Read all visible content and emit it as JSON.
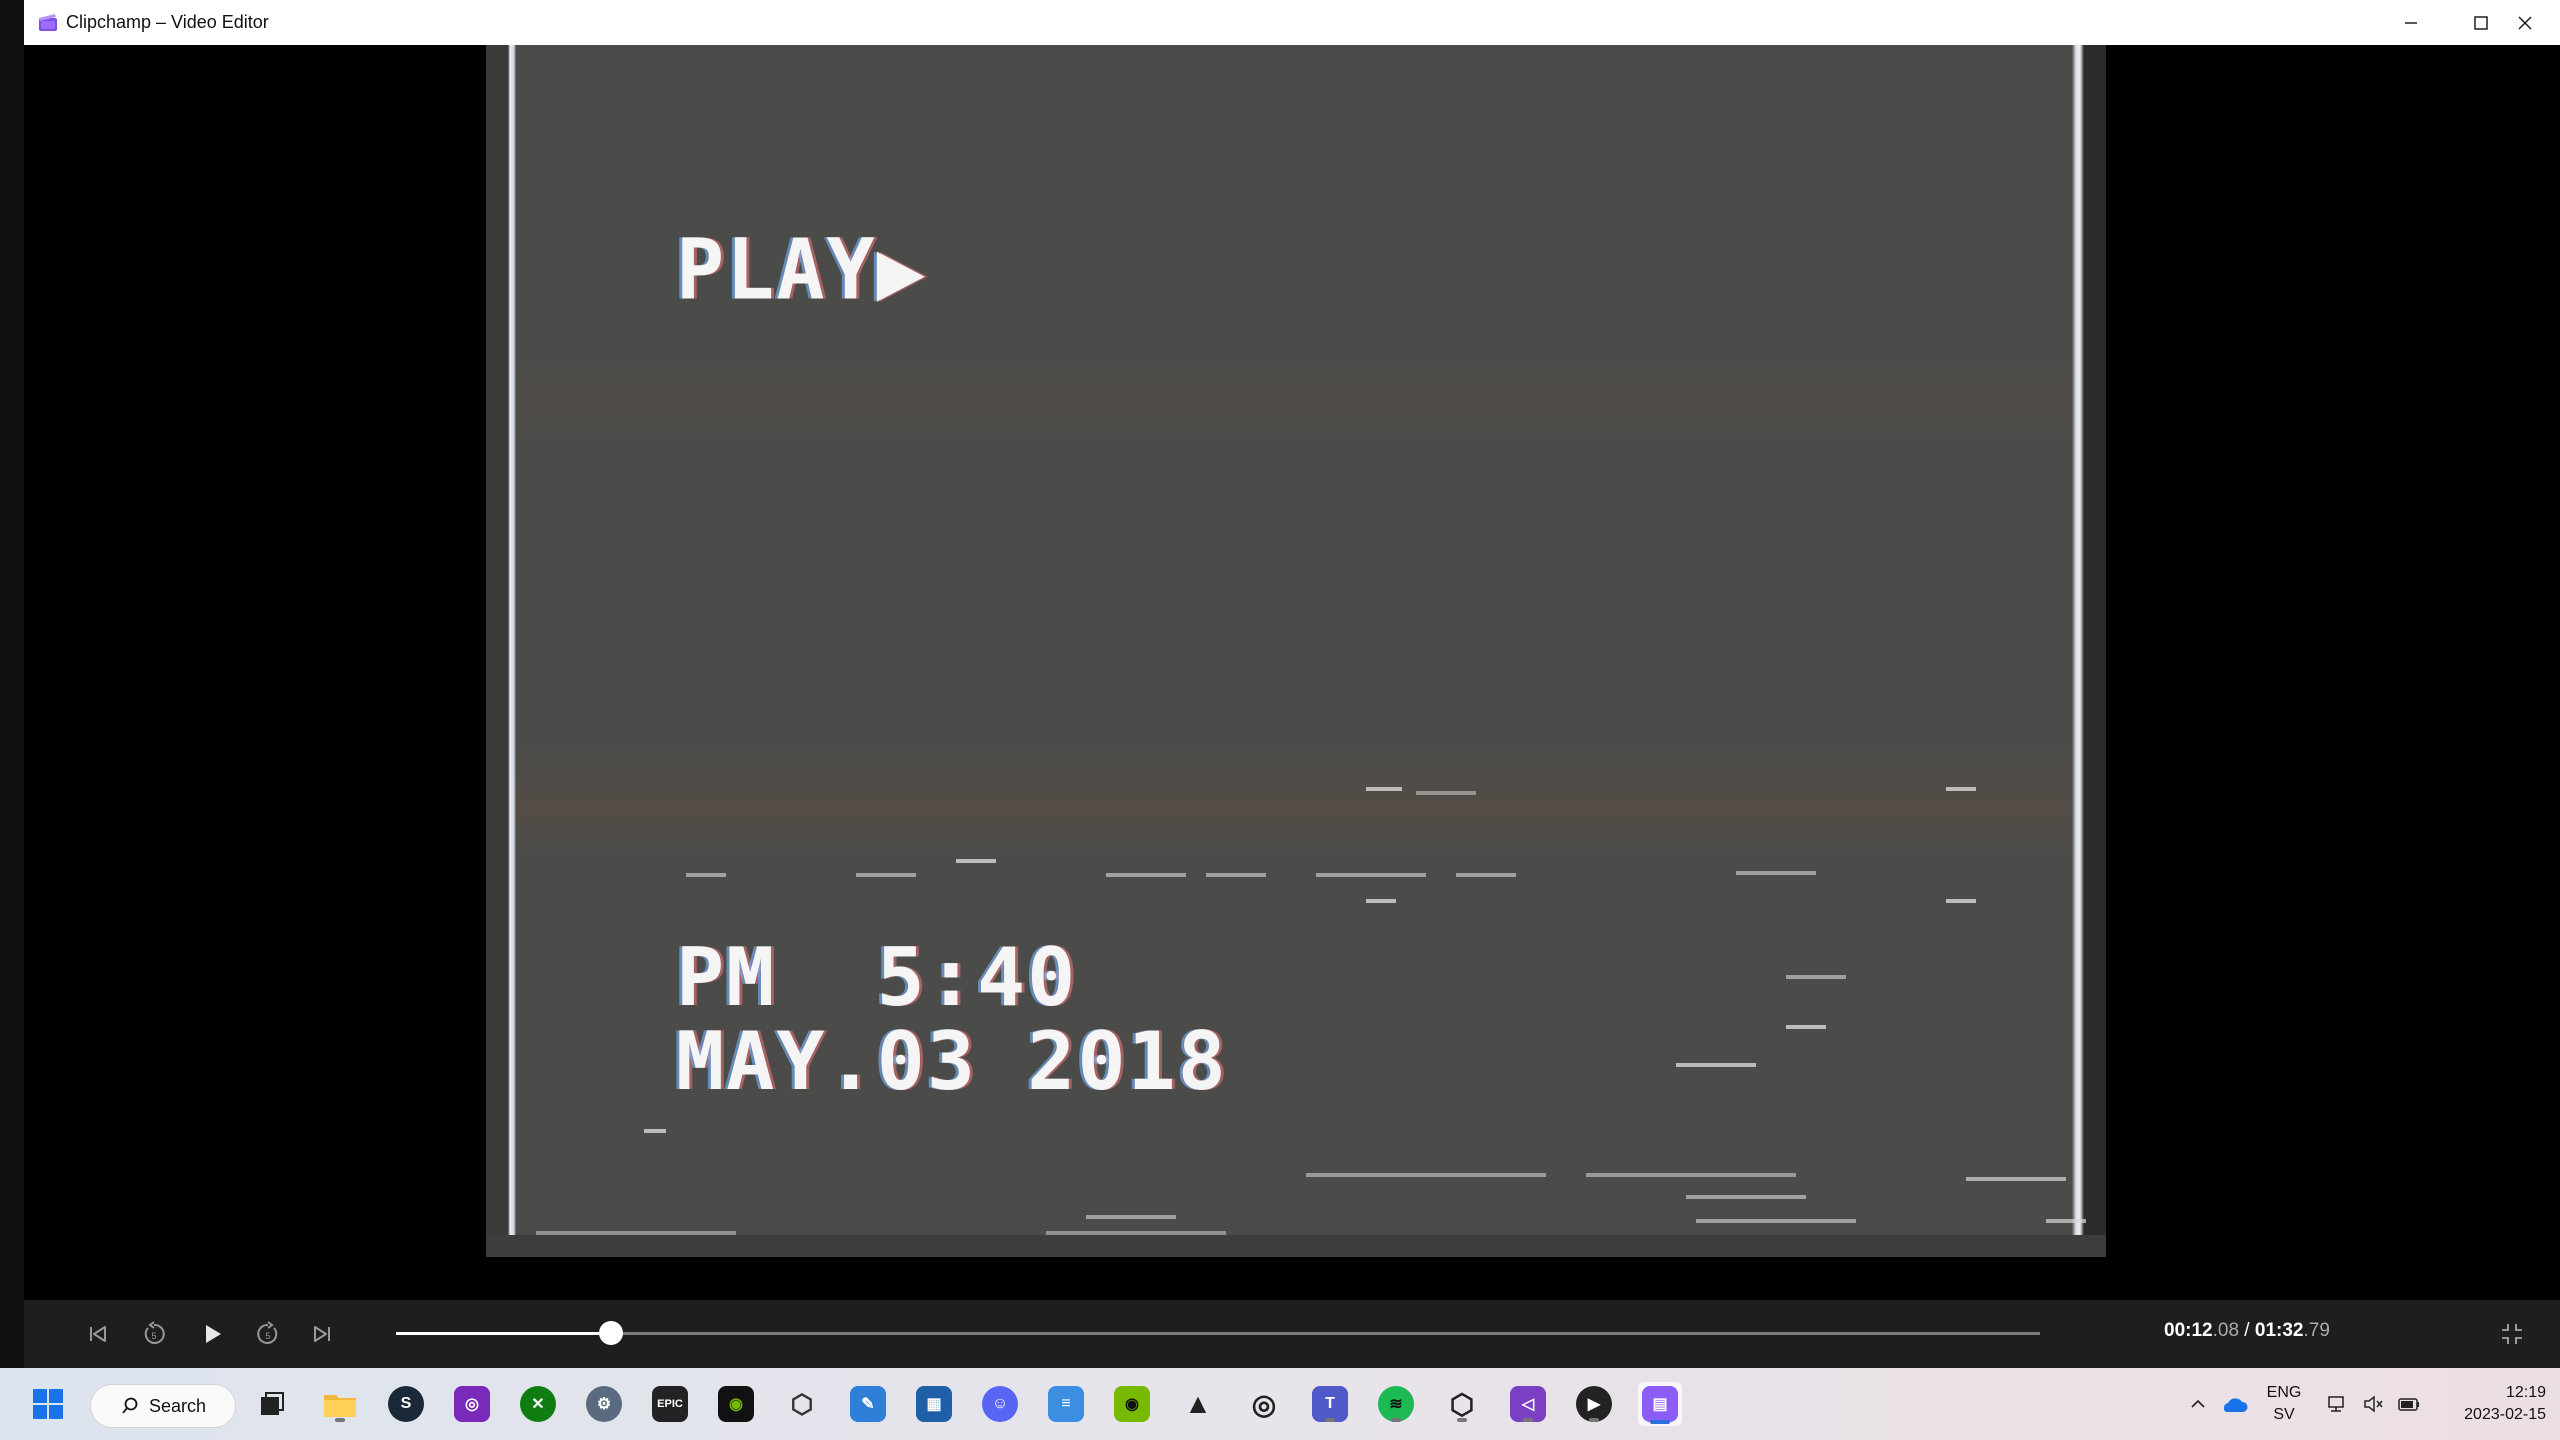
{
  "window": {
    "title": "Clipchamp – Video Editor"
  },
  "video": {
    "osd_mode": "PLAY▶",
    "osd_time": "PM  5:40",
    "osd_date": "MAY.03 2018"
  },
  "player": {
    "current_time_main": "00:12",
    "current_time_frac": ".08",
    "separator": " / ",
    "total_time_main": "01:32",
    "total_time_frac": ".79",
    "progress_fraction": 0.131
  },
  "taskbar": {
    "search_label": "Search",
    "lang_line1": "ENG",
    "lang_line2": "SV",
    "time": "12:19",
    "date": "2023-02-15"
  }
}
